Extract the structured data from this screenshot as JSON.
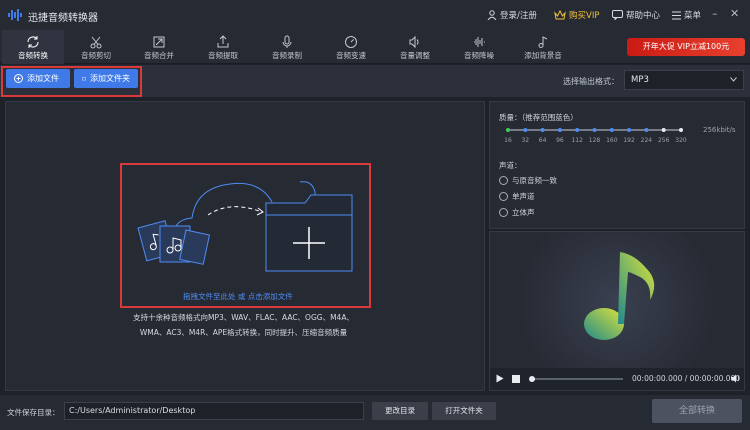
{
  "app": {
    "title": "迅捷音频转换器"
  },
  "topbar": {
    "login": "登录/注册",
    "buy_vip": "购买VIP",
    "help": "帮助中心",
    "menu": "菜单"
  },
  "tabs": [
    {
      "label": "音频转换",
      "icon": "refresh-icon",
      "active": true
    },
    {
      "label": "音频剪切",
      "icon": "scissors-icon",
      "active": false
    },
    {
      "label": "音频合并",
      "icon": "merge-icon",
      "active": false
    },
    {
      "label": "音频提取",
      "icon": "extract-icon",
      "active": false
    },
    {
      "label": "音频录制",
      "icon": "microphone-icon",
      "active": false
    },
    {
      "label": "音频变速",
      "icon": "speed-icon",
      "active": false
    },
    {
      "label": "音量调整",
      "icon": "volume-icon",
      "active": false
    },
    {
      "label": "音频降噪",
      "icon": "waveform-icon",
      "active": false
    },
    {
      "label": "添加背景音",
      "icon": "music-note-icon",
      "active": false
    }
  ],
  "promo": {
    "label": "开年大促 VIP立减100元"
  },
  "toolbar": {
    "add_file": "添加文件",
    "add_folder": "添加文件夹",
    "format_label": "选择输出格式：",
    "format_value": "MP3"
  },
  "dropzone": {
    "hint": "拖拽文件至此处 或 点击添加文件",
    "desc_line1": "支持十余种音频格式向MP3、WAV、FLAC、AAC、OGG、M4A、",
    "desc_line2": "WMA、AC3、M4R、APE格式转换，同时提升、压缩音频质量"
  },
  "quality": {
    "label": "质量：（推荐范围蓝色）",
    "ticks": [
      "16",
      "32",
      "64",
      "96",
      "112",
      "128",
      "160",
      "192",
      "224",
      "256",
      "320"
    ],
    "selected_index": 0,
    "value": "256kbit/s"
  },
  "channel": {
    "label": "声道：",
    "options": [
      "与原音频一致",
      "单声道",
      "立体声"
    ]
  },
  "player": {
    "time": "00:00:00.000 / 00:00:00.000",
    "progress": 0
  },
  "bottom": {
    "path_label": "文件保存目录：",
    "path_value": "C:/Users/Administrator/Desktop",
    "change_dir": "更改目录",
    "open_folder": "打开文件夹",
    "convert_all": "全部转换"
  },
  "colors": {
    "accent": "#3f7ae8",
    "highlight_box": "#d83a3a",
    "vip_gold": "#f2c037",
    "promo_red": "#c91b14",
    "note_yellow": "#d9e03a"
  }
}
